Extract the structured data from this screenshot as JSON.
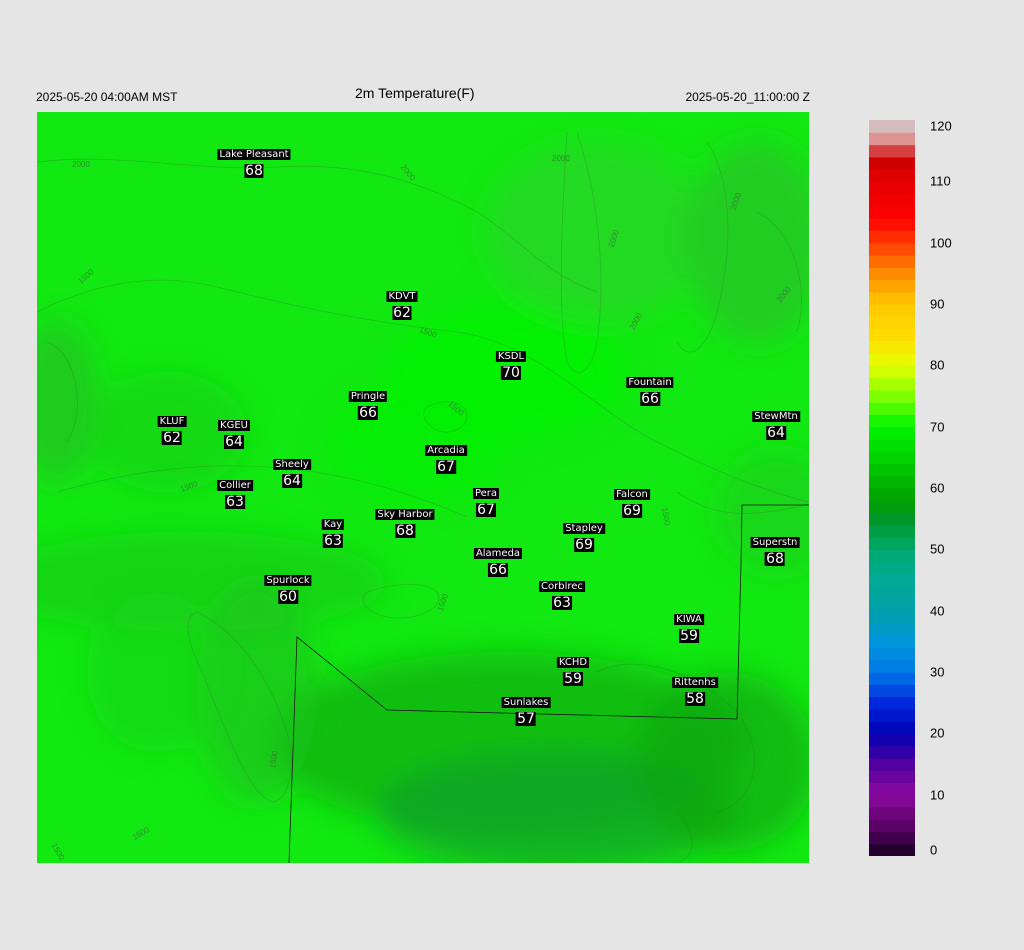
{
  "header": {
    "left_time": "2025-05-20 04:00AM MST",
    "title": "2m Temperature(F)",
    "right_time": "2025-05-20_11:00:00 Z"
  },
  "map": {
    "base_color": "#12e812",
    "contour_labels": [
      "2000",
      "2000",
      "2000",
      "2000",
      "2000",
      "1500",
      "1500",
      "1500",
      "1500",
      "1500",
      "1500",
      "1500",
      "1500",
      "1500",
      "2000",
      "2000"
    ],
    "stations": [
      {
        "name": "Lake Pleasant",
        "value": "68"
      },
      {
        "name": "KDVT",
        "value": "62"
      },
      {
        "name": "KSDL",
        "value": "70"
      },
      {
        "name": "Fountain",
        "value": "66"
      },
      {
        "name": "Pringle",
        "value": "66"
      },
      {
        "name": "StewMtn",
        "value": "64"
      },
      {
        "name": "KLUF",
        "value": "62"
      },
      {
        "name": "KGEU",
        "value": "64"
      },
      {
        "name": "Arcadia",
        "value": "67"
      },
      {
        "name": "Sheely",
        "value": "64"
      },
      {
        "name": "Collier",
        "value": "63"
      },
      {
        "name": "Pera",
        "value": "67"
      },
      {
        "name": "Falcon",
        "value": "69"
      },
      {
        "name": "Sky Harbor",
        "value": "68"
      },
      {
        "name": "Kay",
        "value": "63"
      },
      {
        "name": "Stapley",
        "value": "69"
      },
      {
        "name": "Superstn",
        "value": "68"
      },
      {
        "name": "Alameda",
        "value": "66"
      },
      {
        "name": "Spurlock",
        "value": "60"
      },
      {
        "name": "Corblrec",
        "value": "63"
      },
      {
        "name": "KIWA",
        "value": "59"
      },
      {
        "name": "KCHD",
        "value": "59"
      },
      {
        "name": "Rittenhs",
        "value": "58"
      },
      {
        "name": "Sunlakes",
        "value": "57"
      }
    ]
  },
  "colorbar": {
    "labels": [
      "120",
      "110",
      "100",
      "90",
      "80",
      "70",
      "60",
      "50",
      "40",
      "30",
      "20",
      "10",
      "0"
    ],
    "min": 0,
    "max": 120,
    "stops": [
      {
        "v": 0,
        "c": "#14001e"
      },
      {
        "v": 4,
        "c": "#50005a"
      },
      {
        "v": 10,
        "c": "#8c0aa0"
      },
      {
        "v": 15,
        "c": "#50009c"
      },
      {
        "v": 20,
        "c": "#0000b4"
      },
      {
        "v": 25,
        "c": "#0028dc"
      },
      {
        "v": 30,
        "c": "#0078e6"
      },
      {
        "v": 35,
        "c": "#0096dc"
      },
      {
        "v": 40,
        "c": "#00a0aa"
      },
      {
        "v": 45,
        "c": "#00aa96"
      },
      {
        "v": 50,
        "c": "#00aa6e"
      },
      {
        "v": 55,
        "c": "#009628"
      },
      {
        "v": 58,
        "c": "#00a000"
      },
      {
        "v": 65,
        "c": "#00d200"
      },
      {
        "v": 70,
        "c": "#00f500"
      },
      {
        "v": 75,
        "c": "#7dff00"
      },
      {
        "v": 80,
        "c": "#e6ff00"
      },
      {
        "v": 85,
        "c": "#ffdc00"
      },
      {
        "v": 90,
        "c": "#ffc800"
      },
      {
        "v": 95,
        "c": "#ff8c00"
      },
      {
        "v": 100,
        "c": "#ff3c00"
      },
      {
        "v": 104,
        "c": "#ff0000"
      },
      {
        "v": 110,
        "c": "#e60000"
      },
      {
        "v": 114,
        "c": "#c80000"
      },
      {
        "v": 116,
        "c": "#e08080"
      },
      {
        "v": 120,
        "c": "#d0d0d0"
      }
    ]
  }
}
